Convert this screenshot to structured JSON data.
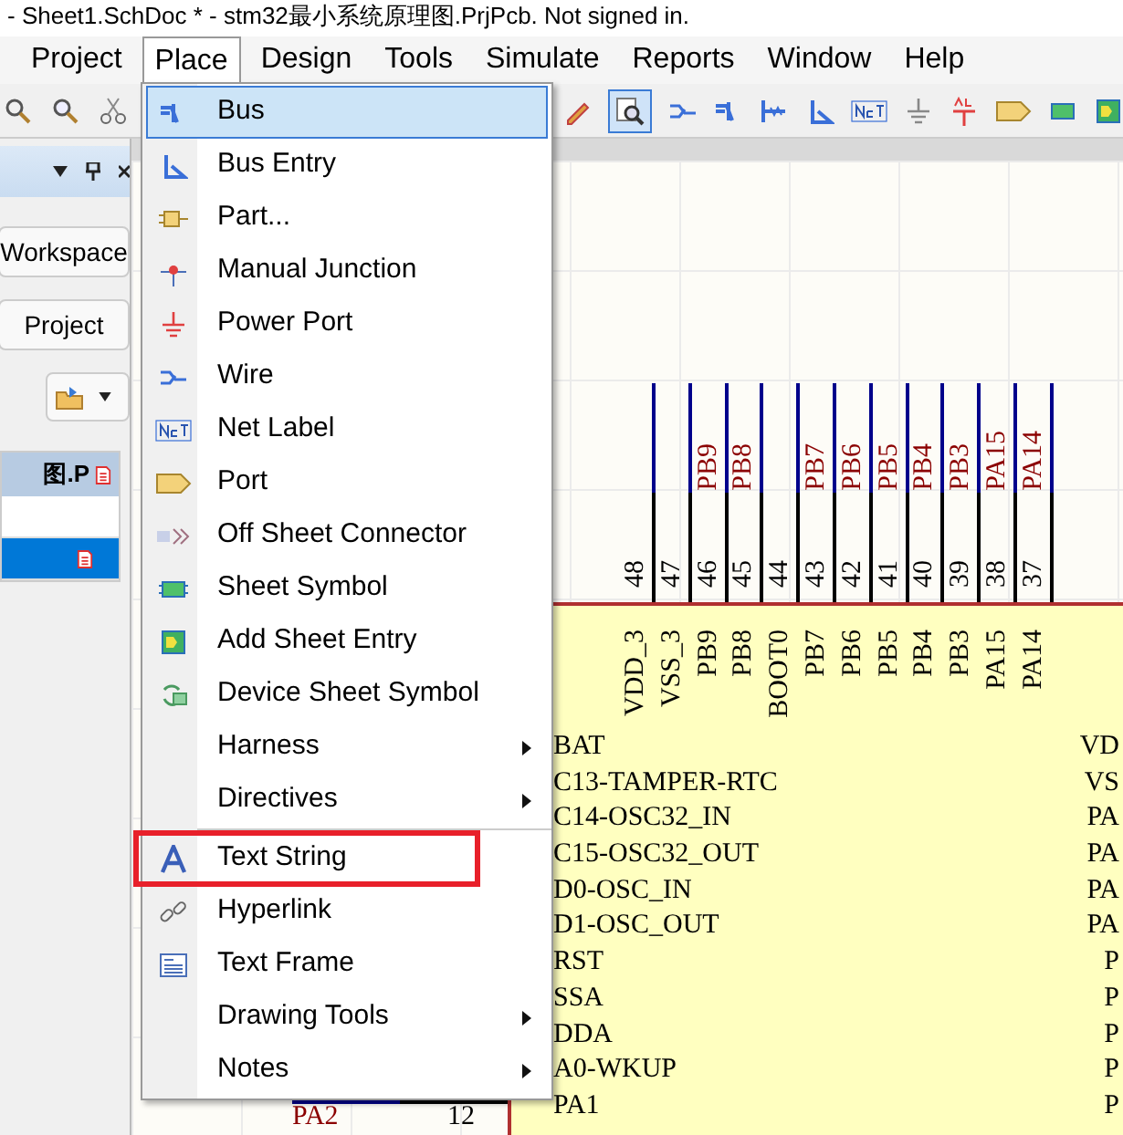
{
  "window": {
    "title": "- Sheet1.SchDoc * - stm32最小系统原理图.PrjPcb. Not signed in."
  },
  "menu_bar": [
    {
      "label": "Project",
      "selected": false
    },
    {
      "label": "Place",
      "selected": true
    },
    {
      "label": "Design",
      "selected": false
    },
    {
      "label": "Tools",
      "selected": false
    },
    {
      "label": "Simulate",
      "selected": false
    },
    {
      "label": "Reports",
      "selected": false
    },
    {
      "label": "Window",
      "selected": false
    },
    {
      "label": "Help",
      "selected": false
    }
  ],
  "left_panel": {
    "buttons": [
      "Workspace",
      "Project"
    ],
    "table_header": "图.P",
    "rows": [
      {
        "selected": false,
        "file_icon": false
      },
      {
        "selected": true,
        "file_icon": true
      }
    ]
  },
  "place_menu": [
    {
      "kind": "item",
      "label": "Bus",
      "selected": true,
      "submenu": false,
      "annotated": false
    },
    {
      "kind": "item",
      "label": "Bus Entry",
      "selected": false,
      "submenu": false,
      "annotated": false
    },
    {
      "kind": "item",
      "label": "Part...",
      "selected": false,
      "submenu": false,
      "annotated": false
    },
    {
      "kind": "item",
      "label": "Manual Junction",
      "selected": false,
      "submenu": false,
      "annotated": false
    },
    {
      "kind": "item",
      "label": "Power Port",
      "selected": false,
      "submenu": false,
      "annotated": false
    },
    {
      "kind": "item",
      "label": "Wire",
      "selected": false,
      "submenu": false,
      "annotated": false
    },
    {
      "kind": "item",
      "label": "Net Label",
      "selected": false,
      "submenu": false,
      "annotated": false
    },
    {
      "kind": "item",
      "label": "Port",
      "selected": false,
      "submenu": false,
      "annotated": false
    },
    {
      "kind": "item",
      "label": "Off Sheet Connector",
      "selected": false,
      "submenu": false,
      "annotated": false
    },
    {
      "kind": "item",
      "label": "Sheet Symbol",
      "selected": false,
      "submenu": false,
      "annotated": false
    },
    {
      "kind": "item",
      "label": "Add Sheet Entry",
      "selected": false,
      "submenu": false,
      "annotated": false
    },
    {
      "kind": "item",
      "label": "Device Sheet Symbol",
      "selected": false,
      "submenu": false,
      "annotated": false
    },
    {
      "kind": "item",
      "label": "Harness",
      "selected": false,
      "submenu": true,
      "annotated": false
    },
    {
      "kind": "item",
      "label": "Directives",
      "selected": false,
      "submenu": true,
      "annotated": false
    },
    {
      "kind": "separator"
    },
    {
      "kind": "item",
      "label": "Text String",
      "selected": false,
      "submenu": false,
      "annotated": true
    },
    {
      "kind": "item",
      "label": "Hyperlink",
      "selected": false,
      "submenu": false,
      "annotated": false
    },
    {
      "kind": "item",
      "label": "Text Frame",
      "selected": false,
      "submenu": false,
      "annotated": false
    },
    {
      "kind": "item",
      "label": "Drawing Tools",
      "selected": false,
      "submenu": true,
      "annotated": false
    },
    {
      "kind": "item",
      "label": "Notes",
      "selected": false,
      "submenu": true,
      "annotated": false
    }
  ],
  "schematic": {
    "top_pins": [
      {
        "number": "48",
        "pin": "VDD_3"
      },
      {
        "number": "47",
        "pin": "VSS_3"
      },
      {
        "number": "46",
        "net": "PB9",
        "pin": "PB9"
      },
      {
        "number": "45",
        "net": "PB8",
        "pin": "PB8"
      },
      {
        "number": "44",
        "pin": "BOOT0"
      },
      {
        "number": "43",
        "net": "PB7",
        "pin": "PB7"
      },
      {
        "number": "42",
        "net": "PB6",
        "pin": "PB6"
      },
      {
        "number": "41",
        "net": "PB5",
        "pin": "PB5"
      },
      {
        "number": "40",
        "net": "PB4",
        "pin": "PB4"
      },
      {
        "number": "39",
        "net": "PB3",
        "pin": "PB3"
      },
      {
        "number": "38",
        "net": "PA15",
        "pin": "PA15"
      },
      {
        "number": "37",
        "net": "PA14",
        "pin": "PA14"
      }
    ],
    "left_pin_names": [
      "BAT",
      "C13-TAMPER-RTC",
      "C14-OSC32_IN",
      "C15-OSC32_OUT",
      "D0-OSC_IN",
      "D1-OSC_OUT",
      "RST",
      "SSA",
      "DDA",
      "A0-WKUP",
      "PA1"
    ],
    "right_pin_names": [
      "VD",
      "VS",
      "PA",
      "PA",
      "PA",
      "PA",
      "P",
      "P",
      "P",
      "P",
      "P"
    ],
    "left_pin": {
      "net": "PA2",
      "number": "12"
    }
  }
}
